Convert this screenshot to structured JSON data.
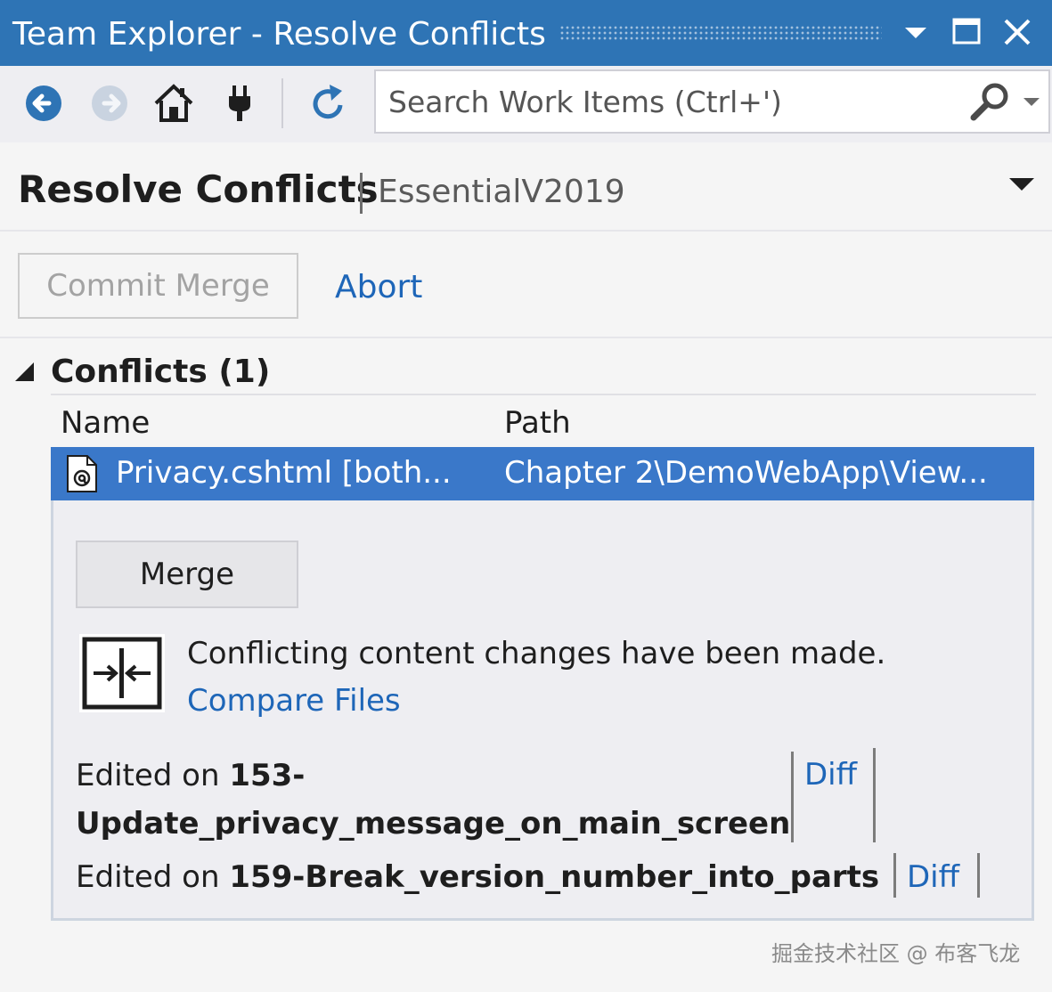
{
  "window": {
    "title": "Team Explorer - Resolve Conflicts",
    "controls": [
      "chevron-down-icon",
      "maximize-icon",
      "close-icon"
    ],
    "accent_color": "#2e74b5"
  },
  "toolbar": {
    "buttons": [
      "back-arrow-icon",
      "forward-arrow-icon",
      "home-icon",
      "plug-icon",
      "refresh-icon"
    ],
    "search": {
      "placeholder": "Search Work Items (Ctrl+')",
      "value": ""
    }
  },
  "header": {
    "title": "Resolve Conflicts",
    "repository": "EssentialV2019"
  },
  "actions": {
    "commit_merge": "Commit Merge",
    "abort": "Abort"
  },
  "conflicts": {
    "section_title": "Conflicts (1)",
    "columns": {
      "name": "Name",
      "path": "Path"
    },
    "rows": [
      {
        "name": "Privacy.cshtml [both...",
        "path": "Chapter 2\\DemoWebApp\\View...",
        "icon": "razor-file-icon",
        "selected": true
      }
    ],
    "details": {
      "merge_button": "Merge",
      "message": "Conflicting content changes have been made.",
      "compare_link": "Compare Files",
      "edits": [
        {
          "prefix": "Edited on",
          "branch": "153-Update_privacy_message_on_main_screen",
          "diff_label": "Diff"
        },
        {
          "prefix": "Edited on",
          "branch": "159-Break_version_number_into_parts",
          "diff_label": "Diff"
        }
      ]
    }
  },
  "colors": {
    "selection": "#3a78c9",
    "link": "#1e66b8"
  },
  "watermark": "掘金技术社区 @ 布客飞龙"
}
